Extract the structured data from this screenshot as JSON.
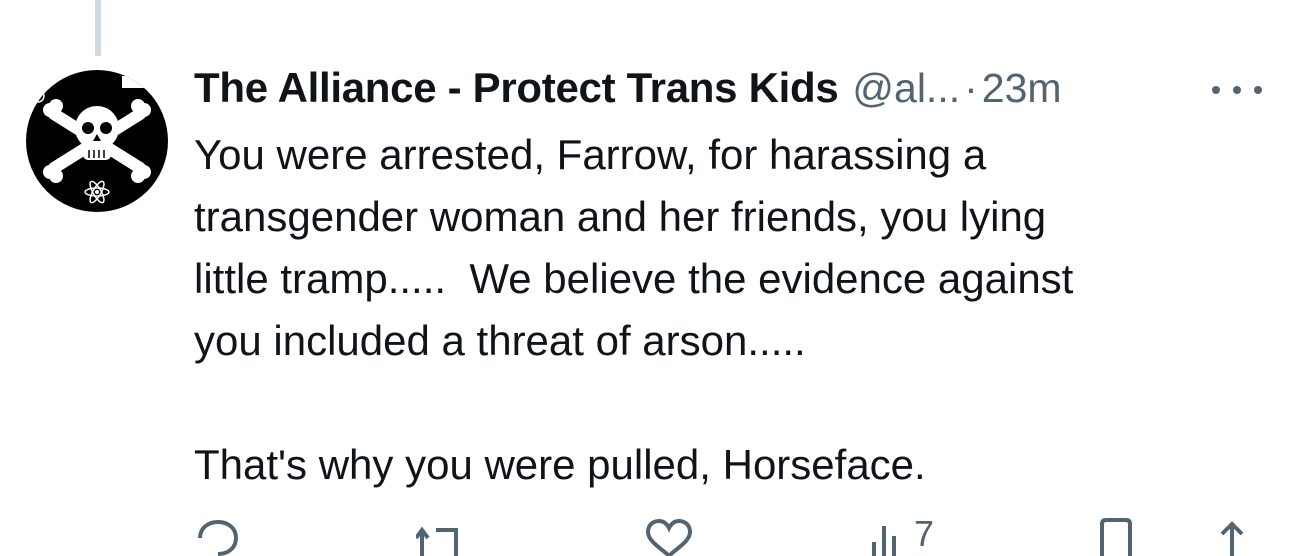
{
  "tweet": {
    "author_name": "The Alliance - Protect Trans Kids",
    "handle": "@al...",
    "separator": "·",
    "time": "23m",
    "text": "You were arrested, Farrow, for harassing a\ntransgender woman and her friends, you lying\nlittle tramp.....  We believe the evidence against\nyou included a threat of arson.....\n\nThat's why you were pulled, Horseface."
  },
  "actions": {
    "views_count": "7"
  },
  "icons": {
    "reply": "reply-icon",
    "retweet": "retweet-icon",
    "like": "heart-icon",
    "views": "views-chart-icon",
    "bookmark": "bookmark-icon",
    "share": "share-icon",
    "more": "more-icon"
  },
  "colors": {
    "text_primary": "#0f1419",
    "text_secondary": "#536471",
    "thread_line": "#cfd9de"
  }
}
